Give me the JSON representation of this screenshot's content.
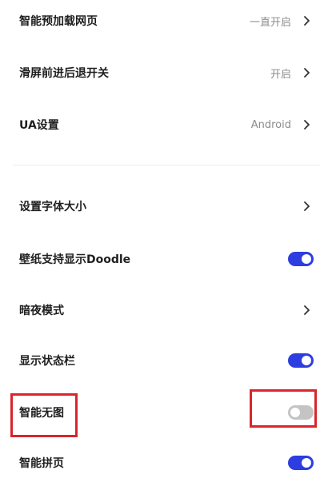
{
  "settings": {
    "items": [
      {
        "label": "智能预加载网页",
        "value": "一直开启",
        "control": "chevron"
      },
      {
        "label": "滑屏前进后退开关",
        "value": "开启",
        "control": "chevron"
      },
      {
        "label": "UA设置",
        "value": "Android",
        "control": "chevron"
      },
      {
        "label": "设置字体大小",
        "value": "",
        "control": "chevron"
      },
      {
        "label": "壁纸支持显示Doodle",
        "control": "toggle",
        "state": "on"
      },
      {
        "label": "暗夜模式",
        "value": "",
        "control": "chevron"
      },
      {
        "label": "显示状态栏",
        "control": "toggle",
        "state": "on"
      },
      {
        "label": "智能无图",
        "control": "toggle",
        "state": "off"
      },
      {
        "label": "智能拼页",
        "control": "toggle",
        "state": "on"
      }
    ]
  },
  "colors": {
    "toggle_on": "#2d3de0",
    "toggle_off": "#c4c4c4",
    "highlight": "#d8262c",
    "label_text": "#1f1f1f",
    "value_text": "#8c8c8c"
  },
  "icons": {
    "chevron": "chevron-right-icon"
  }
}
